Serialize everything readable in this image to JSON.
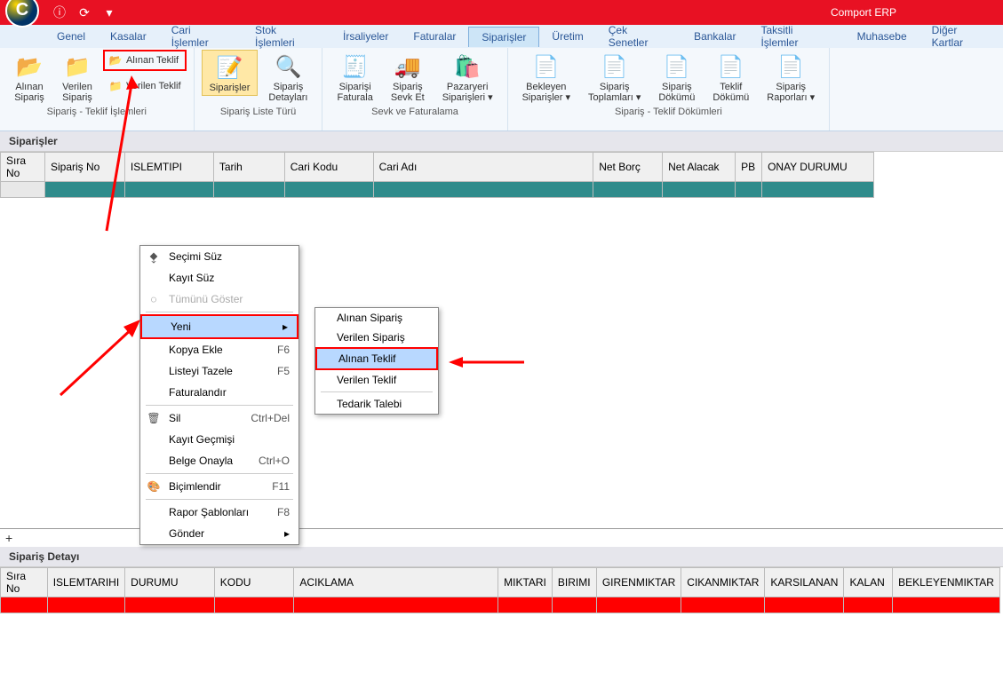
{
  "titlebar": {
    "app_title": "Comport ERP"
  },
  "menubar": {
    "items": [
      "Genel",
      "Kasalar",
      "Cari İşlemler",
      "Stok İşlemleri",
      "İrsaliyeler",
      "Faturalar",
      "Siparişler",
      "Üretim",
      "Çek Senetler",
      "Bankalar",
      "Taksitli İşlemler",
      "Muhasebe",
      "Diğer Kartlar"
    ],
    "active_index": 6
  },
  "ribbon": {
    "group1_title": "Sipariş - Teklif İşlemleri",
    "group1": {
      "alinan_siparis": "Alınan\nSipariş",
      "verilen_siparis": "Verilen\nSipariş",
      "alinan_teklif": "Alınan Teklif",
      "verilen_teklif": "Verilen Teklif"
    },
    "group2_title": "Sipariş Liste Türü",
    "group2": {
      "siparisler": "Siparişler",
      "siparis_detay": "Sipariş\nDetayları"
    },
    "group3_title": "Sevk ve Faturalama",
    "group3": {
      "siparisi_fatura": "Siparişi\nFaturala",
      "siparis_sevk": "Sipariş\nSevk Et",
      "pazaryeri": "Pazaryeri\nSiparişleri ▾"
    },
    "group4_title": "Sipariş - Teklif Dökümleri",
    "group4": {
      "bekleyen": "Bekleyen\nSiparişler ▾",
      "toplamlari": "Sipariş\nToplamları ▾",
      "dokumu": "Sipariş\nDökümü",
      "teklif_dokumu": "Teklif\nDökümü",
      "raporlari": "Sipariş\nRaporları ▾"
    }
  },
  "panel1_title": "Siparişler",
  "table1_cols": [
    "Sıra No",
    "Sipariş No",
    "ISLEMTIPI",
    "Tarih",
    "Cari Kodu",
    "Cari Adı",
    "Net Borç",
    "Net Alacak",
    "PB",
    "ONAY DURUMU"
  ],
  "panel2_title": "Sipariş Detayı",
  "table2_cols": [
    "Sıra No",
    "ISLEMTARIHI",
    "DURUMU",
    "KODU",
    "ACIKLAMA",
    "MIKTARI",
    "BIRIMI",
    "GIRENMIKTAR",
    "CIKANMIKTAR",
    "KARSILANAN",
    "KALAN",
    "BEKLEYENMIKTAR"
  ],
  "ctx1": {
    "items": [
      {
        "label": "Seçimi Süz",
        "icon": "filter"
      },
      {
        "label": "Kayıt Süz"
      },
      {
        "label": "Tümünü Göster",
        "disabled": true
      },
      {
        "sep": true
      },
      {
        "label": "Yeni",
        "arrow": true,
        "highlighted": true
      },
      {
        "label": "Kopya Ekle",
        "shortcut": "F6"
      },
      {
        "label": "Listeyi Tazele",
        "shortcut": "F5"
      },
      {
        "label": "Faturalandır"
      },
      {
        "sep": true
      },
      {
        "label": "Sil",
        "shortcut": "Ctrl+Del",
        "icon": "delete"
      },
      {
        "label": "Kayıt Geçmişi"
      },
      {
        "label": "Belge Onayla",
        "shortcut": "Ctrl+O"
      },
      {
        "sep": true
      },
      {
        "label": "Biçimlendir",
        "shortcut": "F11",
        "icon": "format"
      },
      {
        "sep": true
      },
      {
        "label": "Rapor Şablonları",
        "shortcut": "F8"
      },
      {
        "label": "Gönder",
        "arrow": true
      }
    ]
  },
  "ctx2": {
    "items": [
      "Alınan Sipariş",
      "Verilen Sipariş",
      "Alınan Teklif",
      "Verilen Teklif",
      "Tedarik Talebi"
    ],
    "highlighted_index": 2
  }
}
